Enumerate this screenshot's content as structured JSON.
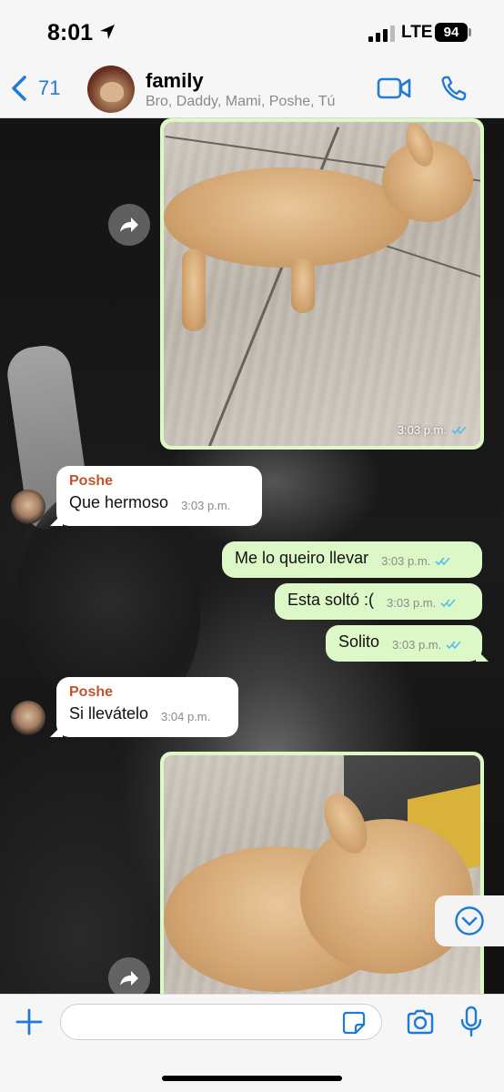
{
  "status_bar": {
    "time": "8:01",
    "network": "LTE",
    "battery": "94"
  },
  "header": {
    "back_count": "71",
    "group_name": "family",
    "members": "Bro, Daddy, Mami, Poshe, Tú"
  },
  "messages": [
    {
      "type": "image",
      "direction": "out",
      "time": "3:03 p.m.",
      "read": true
    },
    {
      "type": "text",
      "direction": "in",
      "sender": "Poshe",
      "text": "Que hermoso",
      "time": "3:03 p.m."
    },
    {
      "type": "text",
      "direction": "out",
      "text": "Me lo queiro llevar",
      "time": "3:03 p.m.",
      "read": true
    },
    {
      "type": "text",
      "direction": "out",
      "text": "Esta soltó :(",
      "time": "3:03 p.m.",
      "read": true
    },
    {
      "type": "text",
      "direction": "out",
      "text": "Solito",
      "time": "3:03 p.m.",
      "read": true
    },
    {
      "type": "text",
      "direction": "in",
      "sender": "Poshe",
      "text": "Si llevátelo",
      "time": "3:04 p.m."
    },
    {
      "type": "image",
      "direction": "out"
    }
  ],
  "input": {
    "placeholder": "",
    "value": ""
  },
  "colors": {
    "accent": "#1f7bd8",
    "outgoing_bubble": "#dcf8c6",
    "incoming_bubble": "#ffffff",
    "sender_name": "#c0552b",
    "read_ticks": "#53bdeb"
  },
  "icons": [
    "location-arrow-icon",
    "signal-icon",
    "battery-icon",
    "back-chevron-icon",
    "video-call-icon",
    "phone-call-icon",
    "forward-icon",
    "read-receipt-icon",
    "chevron-down-icon",
    "plus-icon",
    "sticker-icon",
    "camera-icon",
    "mic-icon"
  ]
}
